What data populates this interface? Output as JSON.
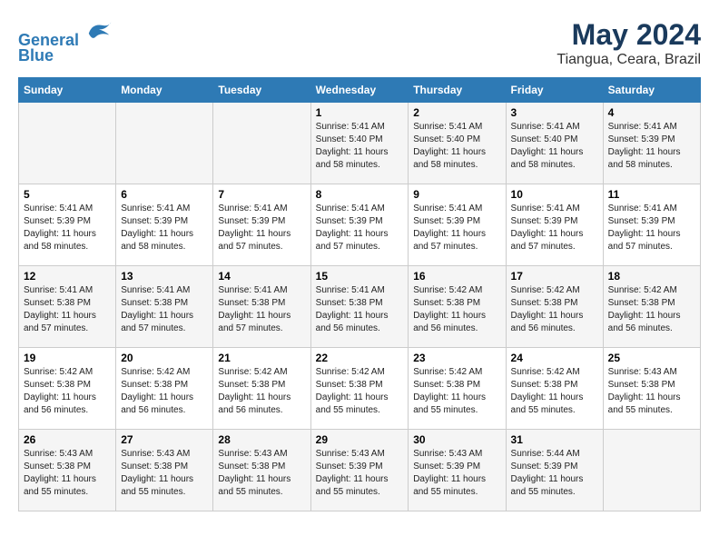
{
  "logo": {
    "line1": "General",
    "line2": "Blue"
  },
  "title": "May 2024",
  "subtitle": "Tiangua, Ceara, Brazil",
  "days_of_week": [
    "Sunday",
    "Monday",
    "Tuesday",
    "Wednesday",
    "Thursday",
    "Friday",
    "Saturday"
  ],
  "weeks": [
    [
      {
        "day": "",
        "info": ""
      },
      {
        "day": "",
        "info": ""
      },
      {
        "day": "",
        "info": ""
      },
      {
        "day": "1",
        "info": "Sunrise: 5:41 AM\nSunset: 5:40 PM\nDaylight: 11 hours and 58 minutes."
      },
      {
        "day": "2",
        "info": "Sunrise: 5:41 AM\nSunset: 5:40 PM\nDaylight: 11 hours and 58 minutes."
      },
      {
        "day": "3",
        "info": "Sunrise: 5:41 AM\nSunset: 5:40 PM\nDaylight: 11 hours and 58 minutes."
      },
      {
        "day": "4",
        "info": "Sunrise: 5:41 AM\nSunset: 5:39 PM\nDaylight: 11 hours and 58 minutes."
      }
    ],
    [
      {
        "day": "5",
        "info": "Sunrise: 5:41 AM\nSunset: 5:39 PM\nDaylight: 11 hours and 58 minutes."
      },
      {
        "day": "6",
        "info": "Sunrise: 5:41 AM\nSunset: 5:39 PM\nDaylight: 11 hours and 58 minutes."
      },
      {
        "day": "7",
        "info": "Sunrise: 5:41 AM\nSunset: 5:39 PM\nDaylight: 11 hours and 57 minutes."
      },
      {
        "day": "8",
        "info": "Sunrise: 5:41 AM\nSunset: 5:39 PM\nDaylight: 11 hours and 57 minutes."
      },
      {
        "day": "9",
        "info": "Sunrise: 5:41 AM\nSunset: 5:39 PM\nDaylight: 11 hours and 57 minutes."
      },
      {
        "day": "10",
        "info": "Sunrise: 5:41 AM\nSunset: 5:39 PM\nDaylight: 11 hours and 57 minutes."
      },
      {
        "day": "11",
        "info": "Sunrise: 5:41 AM\nSunset: 5:39 PM\nDaylight: 11 hours and 57 minutes."
      }
    ],
    [
      {
        "day": "12",
        "info": "Sunrise: 5:41 AM\nSunset: 5:38 PM\nDaylight: 11 hours and 57 minutes."
      },
      {
        "day": "13",
        "info": "Sunrise: 5:41 AM\nSunset: 5:38 PM\nDaylight: 11 hours and 57 minutes."
      },
      {
        "day": "14",
        "info": "Sunrise: 5:41 AM\nSunset: 5:38 PM\nDaylight: 11 hours and 57 minutes."
      },
      {
        "day": "15",
        "info": "Sunrise: 5:41 AM\nSunset: 5:38 PM\nDaylight: 11 hours and 56 minutes."
      },
      {
        "day": "16",
        "info": "Sunrise: 5:42 AM\nSunset: 5:38 PM\nDaylight: 11 hours and 56 minutes."
      },
      {
        "day": "17",
        "info": "Sunrise: 5:42 AM\nSunset: 5:38 PM\nDaylight: 11 hours and 56 minutes."
      },
      {
        "day": "18",
        "info": "Sunrise: 5:42 AM\nSunset: 5:38 PM\nDaylight: 11 hours and 56 minutes."
      }
    ],
    [
      {
        "day": "19",
        "info": "Sunrise: 5:42 AM\nSunset: 5:38 PM\nDaylight: 11 hours and 56 minutes."
      },
      {
        "day": "20",
        "info": "Sunrise: 5:42 AM\nSunset: 5:38 PM\nDaylight: 11 hours and 56 minutes."
      },
      {
        "day": "21",
        "info": "Sunrise: 5:42 AM\nSunset: 5:38 PM\nDaylight: 11 hours and 56 minutes."
      },
      {
        "day": "22",
        "info": "Sunrise: 5:42 AM\nSunset: 5:38 PM\nDaylight: 11 hours and 55 minutes."
      },
      {
        "day": "23",
        "info": "Sunrise: 5:42 AM\nSunset: 5:38 PM\nDaylight: 11 hours and 55 minutes."
      },
      {
        "day": "24",
        "info": "Sunrise: 5:42 AM\nSunset: 5:38 PM\nDaylight: 11 hours and 55 minutes."
      },
      {
        "day": "25",
        "info": "Sunrise: 5:43 AM\nSunset: 5:38 PM\nDaylight: 11 hours and 55 minutes."
      }
    ],
    [
      {
        "day": "26",
        "info": "Sunrise: 5:43 AM\nSunset: 5:38 PM\nDaylight: 11 hours and 55 minutes."
      },
      {
        "day": "27",
        "info": "Sunrise: 5:43 AM\nSunset: 5:38 PM\nDaylight: 11 hours and 55 minutes."
      },
      {
        "day": "28",
        "info": "Sunrise: 5:43 AM\nSunset: 5:38 PM\nDaylight: 11 hours and 55 minutes."
      },
      {
        "day": "29",
        "info": "Sunrise: 5:43 AM\nSunset: 5:39 PM\nDaylight: 11 hours and 55 minutes."
      },
      {
        "day": "30",
        "info": "Sunrise: 5:43 AM\nSunset: 5:39 PM\nDaylight: 11 hours and 55 minutes."
      },
      {
        "day": "31",
        "info": "Sunrise: 5:44 AM\nSunset: 5:39 PM\nDaylight: 11 hours and 55 minutes."
      },
      {
        "day": "",
        "info": ""
      }
    ]
  ]
}
